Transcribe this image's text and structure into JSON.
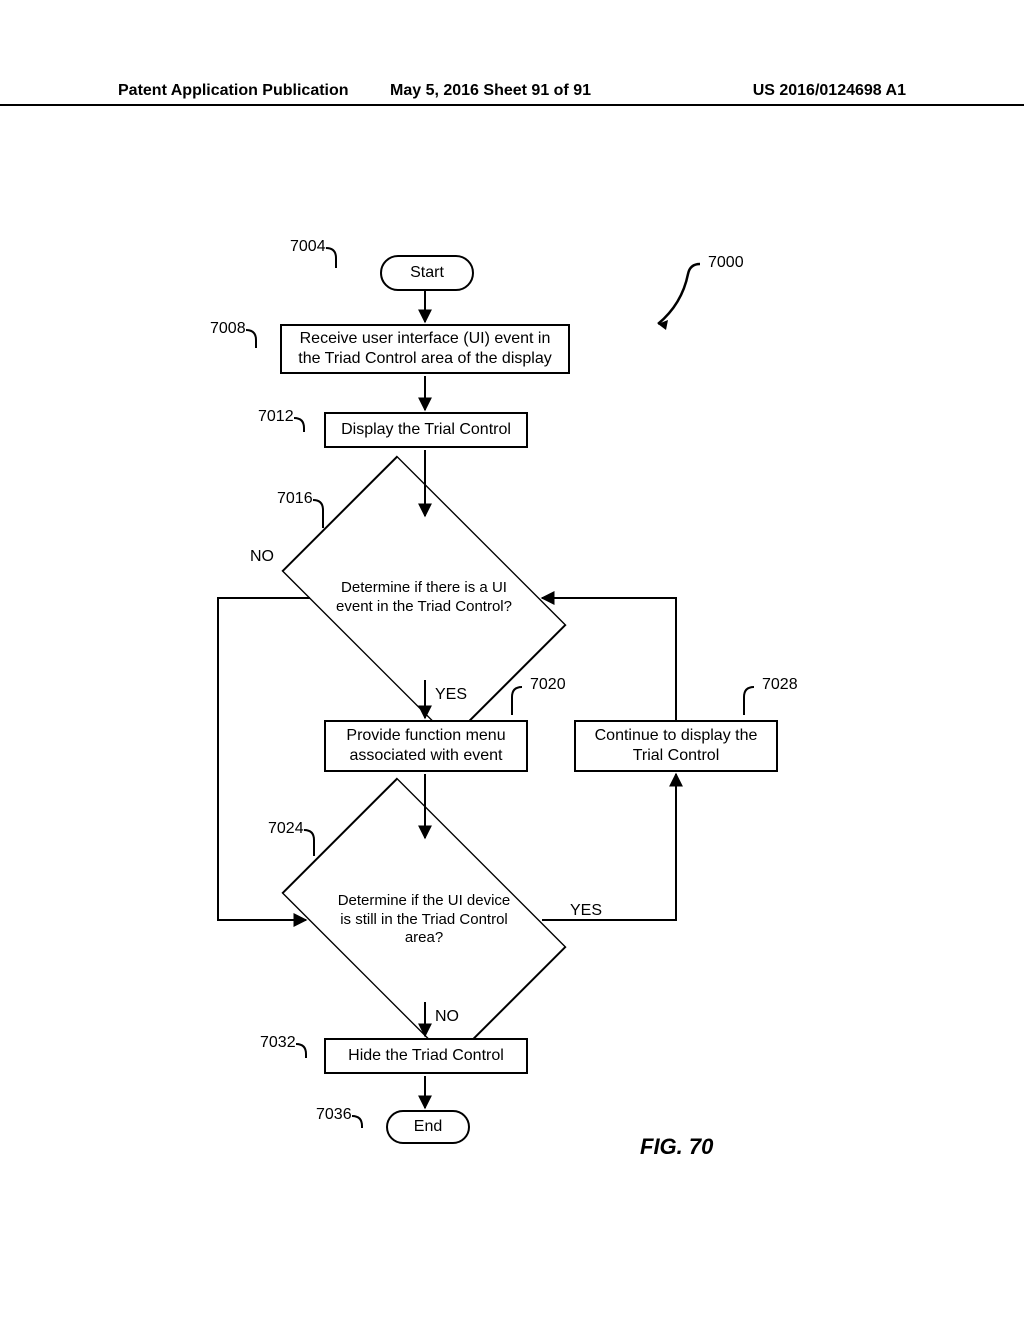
{
  "header": {
    "left": "Patent Application Publication",
    "mid": "May 5, 2016  Sheet 91 of 91",
    "right": "US 2016/0124698 A1"
  },
  "figure_label": "FIG. 70",
  "refs": {
    "r7000": "7000",
    "r7004": "7004",
    "r7008": "7008",
    "r7012": "7012",
    "r7016": "7016",
    "r7020": "7020",
    "r7024": "7024",
    "r7028": "7028",
    "r7032": "7032",
    "r7036": "7036"
  },
  "nodes": {
    "start": "Start",
    "receive": "Receive user interface (UI) event in the Triad Control area of the display",
    "display_trial": "Display the Trial Control",
    "decide_ui_event": "Determine if there is a UI event in the Triad Control?",
    "provide_menu": "Provide function menu associated with event",
    "continue_display": "Continue to display the Trial Control",
    "decide_still_in": "Determine if the UI device is still in the Triad Control area?",
    "hide_triad": "Hide the Triad Control",
    "end": "End"
  },
  "branch": {
    "yes": "YES",
    "no": "NO"
  },
  "chart_data": {
    "type": "flowchart",
    "title": "FIG. 70",
    "figure_ref": "7000",
    "nodes": [
      {
        "id": "7004",
        "type": "terminator",
        "label": "Start"
      },
      {
        "id": "7008",
        "type": "process",
        "label": "Receive user interface (UI) event in the Triad Control area of the display"
      },
      {
        "id": "7012",
        "type": "process",
        "label": "Display the Trial Control"
      },
      {
        "id": "7016",
        "type": "decision",
        "label": "Determine if there is a UI event in the Triad Control?"
      },
      {
        "id": "7020",
        "type": "process",
        "label": "Provide function menu associated with event"
      },
      {
        "id": "7028",
        "type": "process",
        "label": "Continue to display the Trial Control"
      },
      {
        "id": "7024",
        "type": "decision",
        "label": "Determine if the UI device is still in the Triad Control area?"
      },
      {
        "id": "7032",
        "type": "process",
        "label": "Hide the Triad Control"
      },
      {
        "id": "7036",
        "type": "terminator",
        "label": "End"
      }
    ],
    "edges": [
      {
        "from": "7004",
        "to": "7008"
      },
      {
        "from": "7008",
        "to": "7012"
      },
      {
        "from": "7012",
        "to": "7016"
      },
      {
        "from": "7016",
        "to": "7020",
        "label": "YES"
      },
      {
        "from": "7016",
        "to": "7024",
        "label": "NO",
        "routing": "left-down"
      },
      {
        "from": "7020",
        "to": "7024"
      },
      {
        "from": "7024",
        "to": "7028",
        "label": "YES",
        "routing": "right-up"
      },
      {
        "from": "7028",
        "to": "7016",
        "routing": "up-left"
      },
      {
        "from": "7024",
        "to": "7032",
        "label": "NO"
      },
      {
        "from": "7032",
        "to": "7036"
      }
    ]
  }
}
